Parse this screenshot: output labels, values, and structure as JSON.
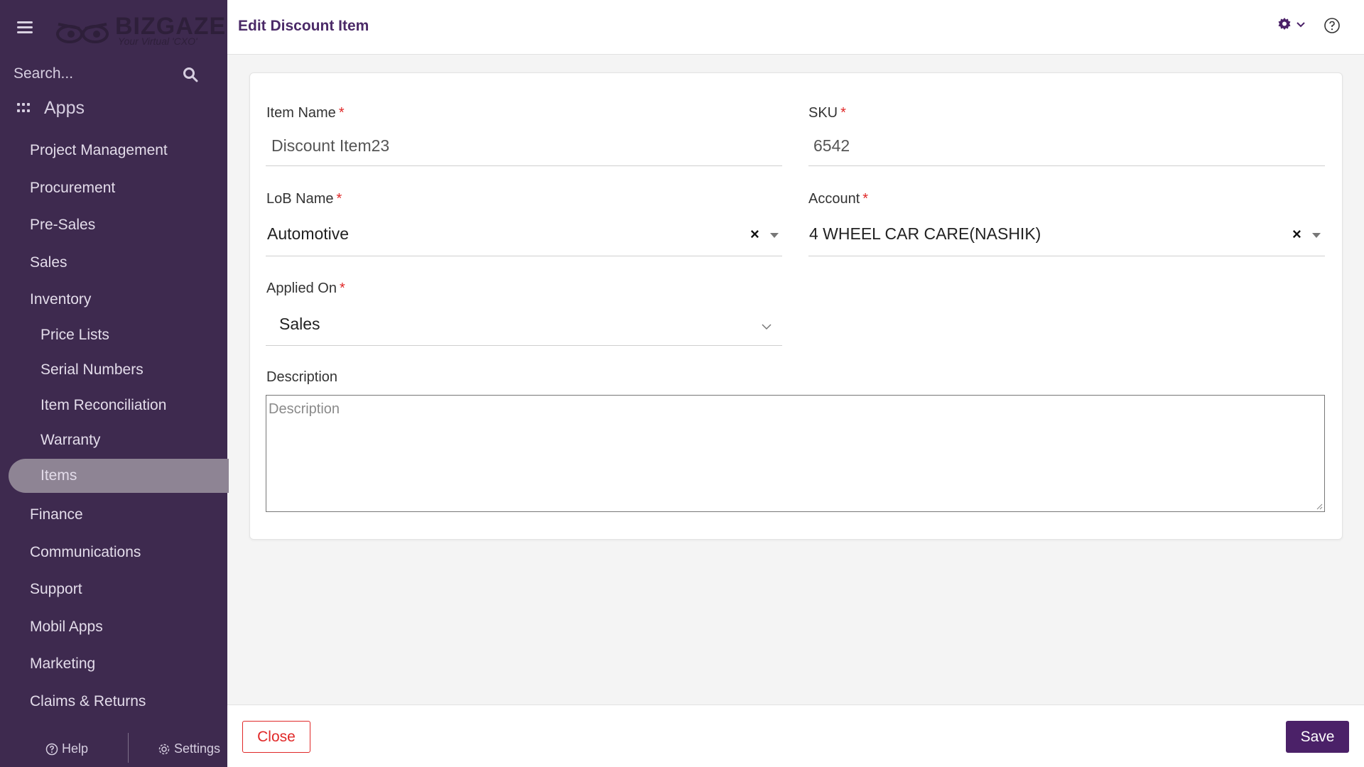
{
  "brand": {
    "name": "BIZGAZE",
    "tagline": "Your Virtual 'CXO'"
  },
  "sidebar": {
    "search_placeholder": "Search...",
    "apps_label": "Apps",
    "items": [
      {
        "label": "Project Management"
      },
      {
        "label": "Procurement"
      },
      {
        "label": "Pre-Sales"
      },
      {
        "label": "Sales"
      },
      {
        "label": "Inventory"
      },
      {
        "label": "Price Lists"
      },
      {
        "label": "Serial Numbers"
      },
      {
        "label": "Item Reconciliation"
      },
      {
        "label": "Warranty"
      },
      {
        "label": "Items",
        "active": true
      },
      {
        "label": "Finance"
      },
      {
        "label": "Communications"
      },
      {
        "label": "Support"
      },
      {
        "label": "Mobil Apps"
      },
      {
        "label": "Marketing"
      },
      {
        "label": "Claims & Returns"
      }
    ],
    "help_label": "Help",
    "settings_label": "Settings"
  },
  "header": {
    "title": "Edit Discount Item"
  },
  "form": {
    "item_name": {
      "label": "Item Name",
      "required_mark": "*",
      "value": "Discount Item23"
    },
    "sku": {
      "label": "SKU",
      "required_mark": "*",
      "value": "6542"
    },
    "lob_name": {
      "label": "LoB Name",
      "required_mark": "*",
      "value": "Automotive",
      "clear": "×"
    },
    "account": {
      "label": "Account",
      "required_mark": "*",
      "value": "4 WHEEL CAR CARE(NASHIK)",
      "clear": "×"
    },
    "applied_on": {
      "label": "Applied On",
      "required_mark": "*",
      "value": "Sales"
    },
    "description": {
      "label": "Description",
      "placeholder": "Description"
    }
  },
  "footer": {
    "close_label": "Close",
    "save_label": "Save"
  },
  "colors": {
    "sidebar_bg": "#3e2a4f",
    "accent": "#4b2168",
    "required": "#e02828",
    "active_item_bg": "#8e8494"
  }
}
